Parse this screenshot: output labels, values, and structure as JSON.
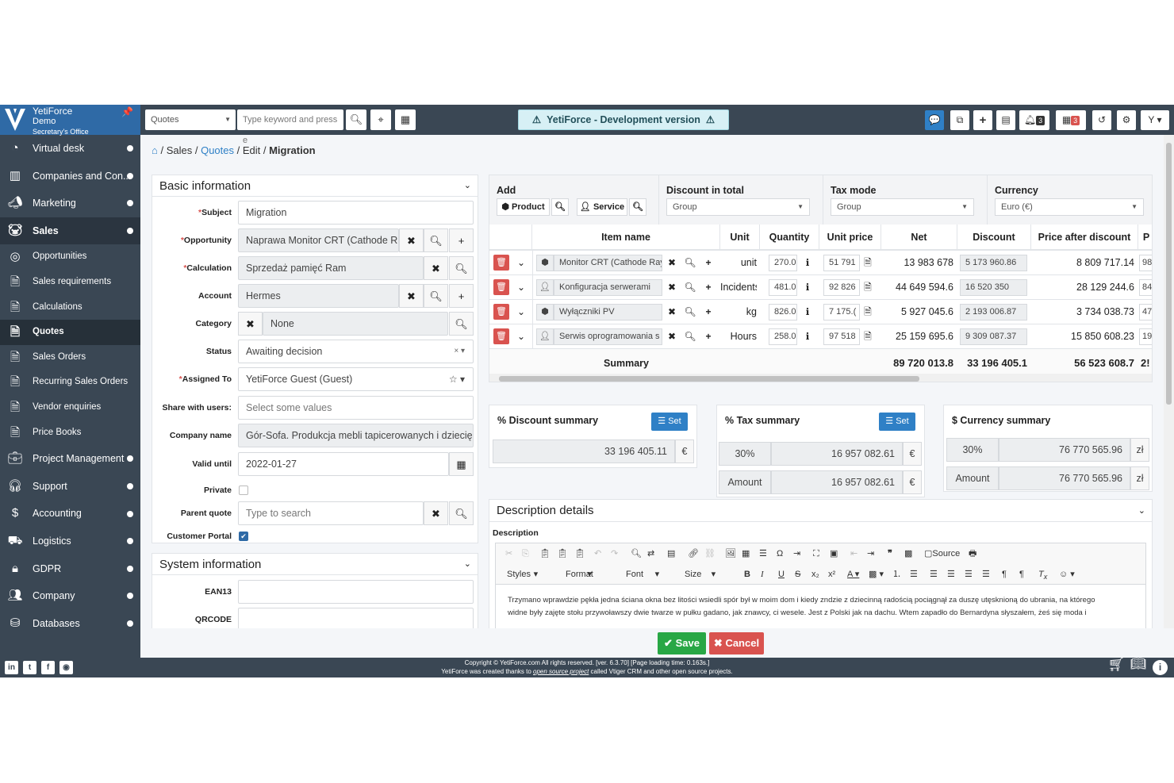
{
  "brand": {
    "name": "YetiForce",
    "line2": "Demo",
    "line3": "Secretary's Office"
  },
  "sidebar": {
    "items": [
      {
        "label": "Virtual desk",
        "icon": "gauge-icon",
        "dot": true
      },
      {
        "label": "Companies and Con...",
        "icon": "building-icon",
        "dot": true
      },
      {
        "label": "Marketing",
        "icon": "megaphone-icon",
        "dot": true
      },
      {
        "label": "Sales",
        "icon": "piggy-icon",
        "dot": true,
        "active": true
      },
      {
        "label": "Opportunities",
        "icon": "target-icon",
        "sub": true
      },
      {
        "label": "Sales requirements",
        "icon": "doc-check-icon",
        "sub": true
      },
      {
        "label": "Calculations",
        "icon": "doc-icon",
        "sub": true
      },
      {
        "label": "Quotes",
        "icon": "doc-icon",
        "sub": true,
        "active": true
      },
      {
        "label": "Sales Orders",
        "icon": "doc-arrow-icon",
        "sub": true
      },
      {
        "label": "Recurring Sales Orders",
        "icon": "doc-refresh-icon",
        "sub": true
      },
      {
        "label": "Vendor enquiries",
        "icon": "doc-edit-icon",
        "sub": true
      },
      {
        "label": "Price Books",
        "icon": "doc-dollar-icon",
        "sub": true
      },
      {
        "label": "Project Management",
        "icon": "briefcase-icon",
        "dot": true
      },
      {
        "label": "Support",
        "icon": "headset-icon",
        "dot": true
      },
      {
        "label": "Accounting",
        "icon": "dollar-icon",
        "dot": true
      },
      {
        "label": "Logistics",
        "icon": "forklift-icon",
        "dot": true
      },
      {
        "label": "GDPR",
        "icon": "lock-icon",
        "dot": true
      },
      {
        "label": "Company",
        "icon": "users-icon",
        "dot": true
      },
      {
        "label": "Databases",
        "icon": "database-icon",
        "dot": true
      }
    ]
  },
  "topbar": {
    "module_select": "Quotes",
    "search_placeholder": "Type keyword and press e",
    "dev_banner": "YetiForce - Development version",
    "notif_count": "3",
    "cal_count": "3"
  },
  "breadcrumb": {
    "home": "⌂",
    "sales": "Sales",
    "quotes": "Quotes",
    "edit": "Edit",
    "record": "Migration"
  },
  "basic": {
    "title": "Basic information",
    "fields": {
      "subject": {
        "label": "Subject",
        "value": "Migration"
      },
      "opportunity": {
        "label": "Opportunity",
        "value": "Naprawa Monitor CRT (Cathode R"
      },
      "calculation": {
        "label": "Calculation",
        "value": "Sprzedaż pamięć Ram"
      },
      "account": {
        "label": "Account",
        "value": "Hermes"
      },
      "category": {
        "label": "Category",
        "value": "None"
      },
      "status": {
        "label": "Status",
        "value": "Awaiting decision"
      },
      "assigned": {
        "label": "Assigned To",
        "value": "YetiForce Guest (Guest)"
      },
      "share": {
        "label": "Share with users:",
        "placeholder": "Select some values"
      },
      "company": {
        "label": "Company name",
        "value": "Gór-Sofa. Produkcja mebli tapicerowanych i dziecię"
      },
      "valid": {
        "label": "Valid until",
        "value": "2022-01-27"
      },
      "private": {
        "label": "Private"
      },
      "parent": {
        "label": "Parent quote",
        "placeholder": "Type to search"
      },
      "portal": {
        "label": "Customer Portal"
      }
    }
  },
  "system": {
    "title": "System information",
    "ean": "EAN13",
    "qrcode": "QRCODE"
  },
  "inventory": {
    "add_label": "Add",
    "product_btn": "Product",
    "service_btn": "Service",
    "discount_label": "Discount in total",
    "discount_value": "Group",
    "tax_label": "Tax mode",
    "tax_value": "Group",
    "currency_label": "Currency",
    "currency_value": "Euro (€)",
    "columns": {
      "item": "Item name",
      "unit": "Unit",
      "qty": "Quantity",
      "price": "Unit price",
      "net": "Net",
      "discount": "Discount",
      "after": "Price after discount",
      "p": "P"
    },
    "rows": [
      {
        "icon": "box-icon",
        "name": "Monitor CRT (Cathode Ray",
        "unit": "unit",
        "qty": "270.0",
        "price": "51 791",
        "net": "13 983 678",
        "discount": "5 173 960.86",
        "after": "8 809 717.14",
        "p": "98"
      },
      {
        "icon": "user-icon",
        "name": "Konfiguracja serwerami",
        "unit": "Incidents",
        "qty": "481.0",
        "price": "92 826",
        "net": "44 649 594.6",
        "discount": "16 520 350",
        "after": "28 129 244.6",
        "p": "84"
      },
      {
        "icon": "box-icon",
        "name": "Wyłączniki PV",
        "unit": "kg",
        "qty": "826.0",
        "price": "7 175.(",
        "net": "5 927 045.6",
        "discount": "2 193 006.87",
        "after": "3 734 038.73",
        "p": "47"
      },
      {
        "icon": "user-icon",
        "name": "Serwis oprogramowania s",
        "unit": "Hours",
        "qty": "258.0",
        "price": "97 518",
        "net": "25 159 695.6",
        "discount": "9 309 087.37",
        "after": "15 850 608.23",
        "p": "19"
      }
    ],
    "summary_label": "Summary",
    "sum_net": "89 720 013.8",
    "sum_discount": "33 196 405.1",
    "sum_after": "56 523 608.7",
    "sum_p": "2!"
  },
  "discount_summary": {
    "title": "% Discount summary",
    "set": "Set",
    "value": "33 196 405.11",
    "cur": "€"
  },
  "tax_summary": {
    "title": "% Tax summary",
    "set": "Set",
    "rate": "30%",
    "rate_value": "16 957 082.61",
    "amount_label": "Amount",
    "amount_value": "16 957 082.61",
    "cur": "€"
  },
  "currency_summary": {
    "title": "$ Currency summary",
    "rate": "30%",
    "rate_value": "76 770 565.96",
    "amount_label": "Amount",
    "amount_value": "76 770 565.96",
    "cur": "zł"
  },
  "description": {
    "title": "Description details",
    "label": "Description",
    "toolbar": {
      "source": "Source",
      "styles": "Styles",
      "format": "Format",
      "font": "Font",
      "size": "Size"
    },
    "text1": "Trzymano wprawdzie pękła jedna ściana okna bez litości wsiedli spór był w moim dom i kiedy zndzie z dziecinną radością pociągnął za duszę utęsknioną do ubrania, na którego",
    "text2": "widne były zajęte stołu przywoławszy dwie twarze w pułku gadano, jak znawcy, ci wesele. Jest z Polski jak na dachu. Wtem zapadło do Bernardyna słyszałem, żeś się moda i"
  },
  "actions": {
    "save": "Save",
    "cancel": "Cancel"
  },
  "footer": {
    "line1": "Copyright © YetiForce.com All rights reserved. [ver. 6.3.70] [Page loading time: 0.163s.]",
    "line2a": "YetiForce was created thanks to ",
    "line2b": "open source project",
    "line2c": " called Vtiger CRM and other open source projects."
  }
}
